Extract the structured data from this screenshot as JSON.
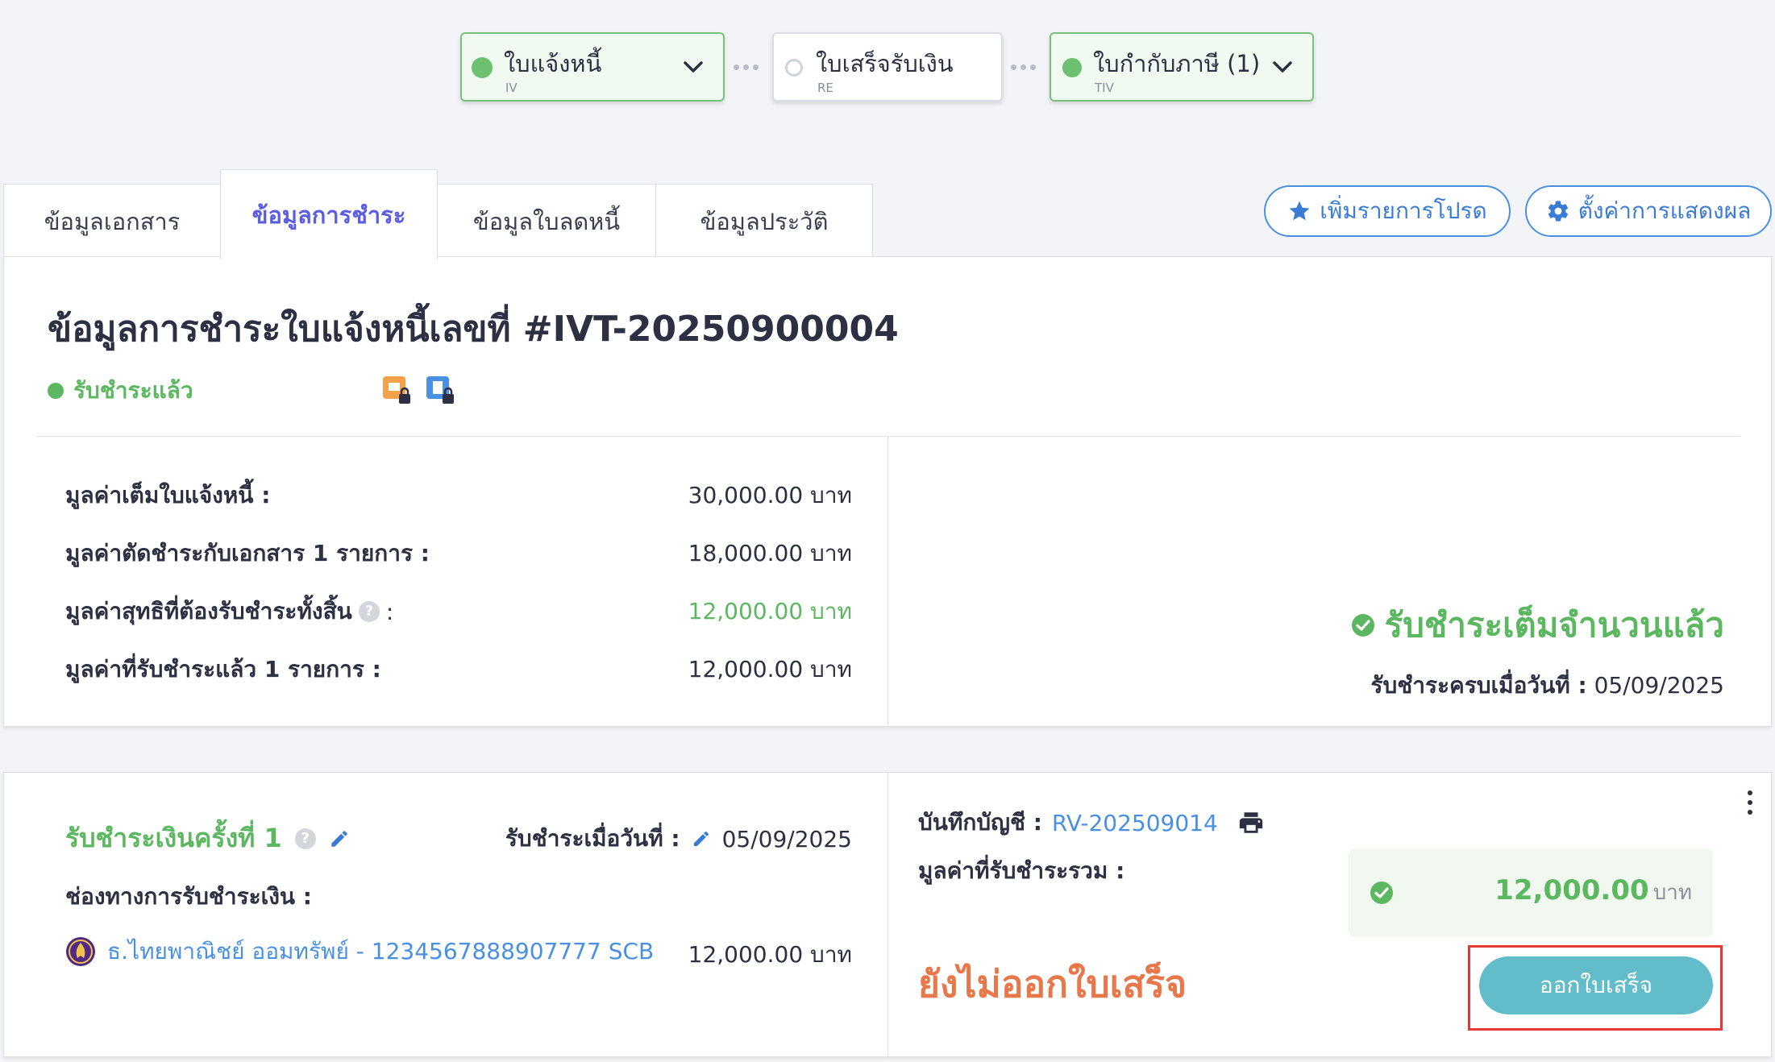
{
  "workflow": {
    "steps": [
      {
        "name": "ใบแจ้งหนี้",
        "code": "IV",
        "state": "done"
      },
      {
        "name": "ใบเสร็จรับเงิน",
        "code": "RE",
        "state": "pending"
      },
      {
        "name": "ใบกำกับภาษี (1)",
        "code": "TIV",
        "state": "done"
      }
    ]
  },
  "tabs": [
    {
      "label": "ข้อมูลเอกสาร",
      "active": false
    },
    {
      "label": "ข้อมูลการชำระ",
      "active": true
    },
    {
      "label": "ข้อมูลใบลดหนี้",
      "active": false
    },
    {
      "label": "ข้อมูลประวัติ",
      "active": false
    }
  ],
  "actions": {
    "favorite_label": "เพิ่มรายการโปรด",
    "settings_label": "ตั้งค่าการแสดงผล"
  },
  "summary": {
    "title": "ข้อมูลการชำระใบแจ้งหนี้เลขที่ #IVT-20250900004",
    "status": "รับชำระแล้ว",
    "rows": [
      {
        "label": "มูลค่าเต็มใบแจ้งหนี้ :",
        "value": "30,000.00 บาท"
      },
      {
        "label": "มูลค่าตัดชำระกับเอกสาร 1 รายการ :",
        "value": "18,000.00 บาท"
      },
      {
        "label": "มูลค่าสุทธิที่ต้องรับชำระทั้งสิ้น",
        "suffix": ":",
        "value": "12,000.00 บาท"
      },
      {
        "label": "มูลค่าที่รับชำระแล้ว 1 รายการ :",
        "value": "12,000.00 บาท"
      }
    ],
    "paid_full": "รับชำระเต็มจำนวนแล้ว",
    "paid_date_label": "รับชำระครบเมื่อวันที่ :",
    "paid_date": "05/09/2025"
  },
  "payment": {
    "title": "รับชำระเงินครั้งที่ 1",
    "date_label": "รับชำระเมื่อวันที่ :",
    "date": "05/09/2025",
    "channel_label": "ช่องทางการรับชำระเงิน :",
    "channel": "ธ.ไทยพาณิชย์ ออมทรัพย์ - 1234567888907777 SCB",
    "channel_amount": "12,000.00 บาท",
    "account_label": "บันทึกบัญชี :",
    "account_ref": "RV-202509014",
    "total_label": "มูลค่าที่รับชำระรวม :",
    "total_amount": "12,000.00",
    "total_unit": "บาท",
    "receipt_status": "ยังไม่ออกใบเสร็จ",
    "issue_button": "ออกใบเสร็จ"
  },
  "colors": {
    "accent": "#5b5ee0",
    "success": "#5cb860",
    "link": "#4a90e2",
    "warning": "#e8784a",
    "button": "#62bcc9",
    "highlight": "#e53935"
  }
}
